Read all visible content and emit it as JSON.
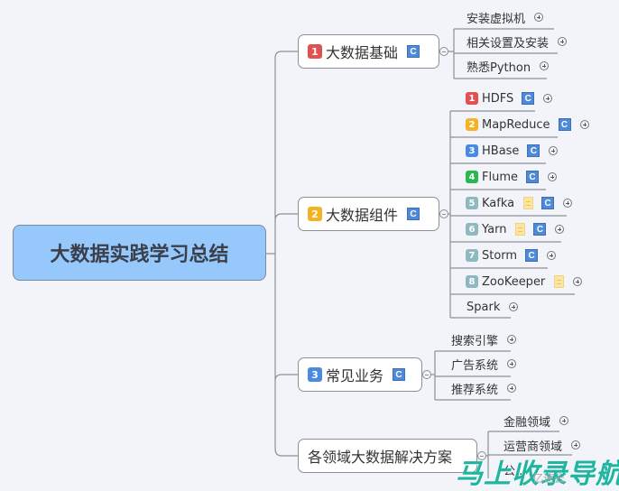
{
  "root": {
    "title": "大数据实践学习总结",
    "color": "#96c8fc"
  },
  "priority_colors": {
    "1": "#e05252",
    "2": "#f5b324",
    "3": "#4a8ae0",
    "4": "#27b94e",
    "other": "#8fb8c0"
  },
  "topics": [
    {
      "label": "大数据基础",
      "priority": "1",
      "has_c_icon": true,
      "children": [
        {
          "label": "安装虚拟机"
        },
        {
          "label": "相关设置及安装"
        },
        {
          "label": "熟悉Python"
        }
      ]
    },
    {
      "label": "大数据组件",
      "priority": "2",
      "has_c_icon": true,
      "children": [
        {
          "label": "HDFS",
          "priority": "1",
          "c": true,
          "note": false
        },
        {
          "label": "MapReduce",
          "priority": "2",
          "c": true,
          "note": false
        },
        {
          "label": "HBase",
          "priority": "3",
          "c": true,
          "note": false
        },
        {
          "label": "Flume",
          "priority": "4",
          "c": true,
          "note": false
        },
        {
          "label": "Kafka",
          "priority": "5",
          "c": true,
          "note": true
        },
        {
          "label": "Yarn",
          "priority": "6",
          "c": true,
          "note": true
        },
        {
          "label": "Storm",
          "priority": "7",
          "c": true,
          "note": false
        },
        {
          "label": "ZooKeeper",
          "priority": "8",
          "c": false,
          "note": true
        },
        {
          "label": "Spark",
          "priority": "",
          "c": false,
          "note": false
        }
      ]
    },
    {
      "label": "常见业务",
      "priority": "3",
      "has_c_icon": true,
      "children": [
        {
          "label": "搜索引擎"
        },
        {
          "label": "广告系统"
        },
        {
          "label": "推荐系统"
        }
      ]
    },
    {
      "label": "各领域大数据解决方案",
      "priority": "",
      "has_c_icon": false,
      "children": [
        {
          "label": "金融领域"
        },
        {
          "label": "运营商领域"
        },
        {
          "label": "公..."
        }
      ]
    }
  ],
  "icons": {
    "c_icon": "C"
  },
  "watermark": {
    "text": "马上收录导航",
    "sub": "亿速云"
  }
}
